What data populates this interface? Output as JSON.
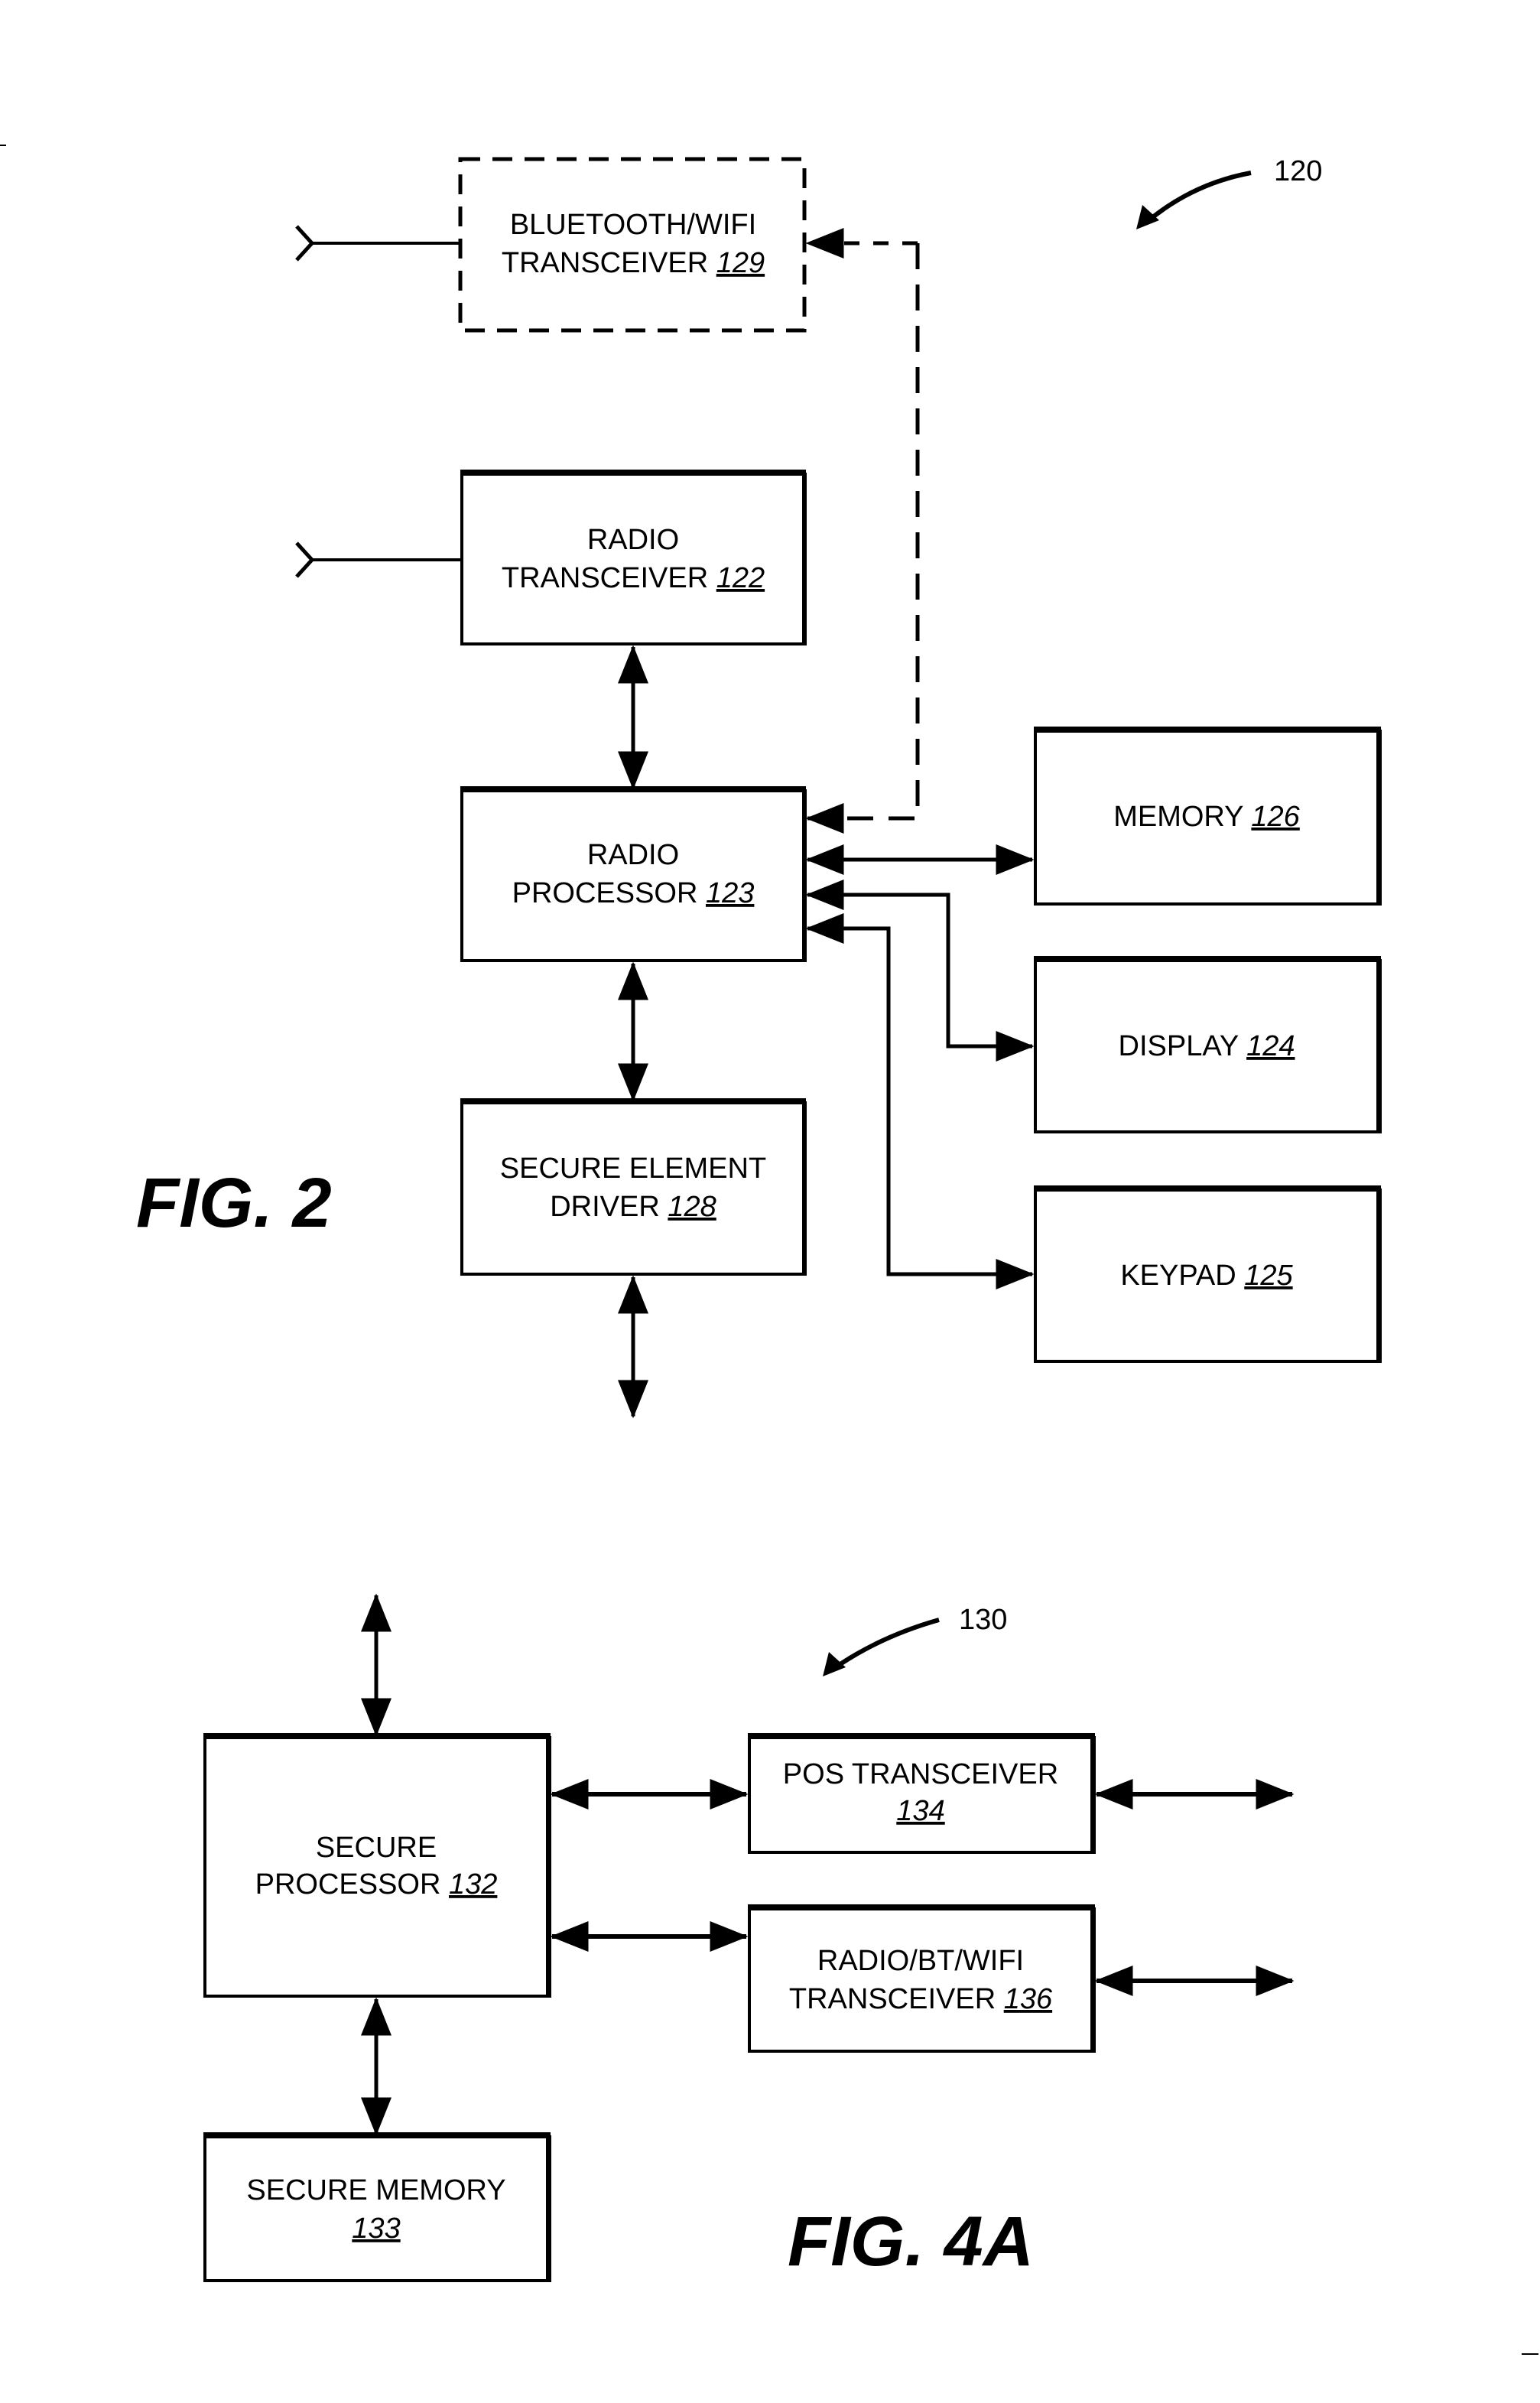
{
  "figures": {
    "fig2": {
      "label": "FIG. 2",
      "reference": "120",
      "blocks": {
        "bt_transceiver": {
          "line1": "BLUETOOTH/WIFI",
          "line2": "TRANSCEIVER ",
          "ref": "129",
          "style": "dashed"
        },
        "radio_transceiver": {
          "line1": "RADIO",
          "line2": "TRANSCEIVER ",
          "ref": "122"
        },
        "radio_processor": {
          "line1": "RADIO",
          "line2": "PROCESSOR ",
          "ref": "123"
        },
        "secure_element_driver": {
          "line1": "SECURE ELEMENT",
          "line2": "DRIVER ",
          "ref": "128"
        },
        "memory": {
          "line1": "MEMORY ",
          "ref": "126"
        },
        "display": {
          "line1": "DISPLAY ",
          "ref": "124"
        },
        "keypad": {
          "line1": "KEYPAD ",
          "ref": "125"
        }
      }
    },
    "fig4a": {
      "label": "FIG. 4A",
      "reference": "130",
      "blocks": {
        "secure_processor": {
          "line1": "SECURE",
          "line2": "PROCESSOR ",
          "ref": "132"
        },
        "pos_transceiver": {
          "line1": "POS TRANSCEIVER",
          "ref": "134"
        },
        "radio_bt_wifi_transceiver": {
          "line1": "RADIO/BT/WIFI",
          "line2": "TRANSCEIVER ",
          "ref": "136"
        },
        "secure_memory": {
          "line1": "SECURE MEMORY",
          "ref": "133"
        }
      }
    }
  }
}
